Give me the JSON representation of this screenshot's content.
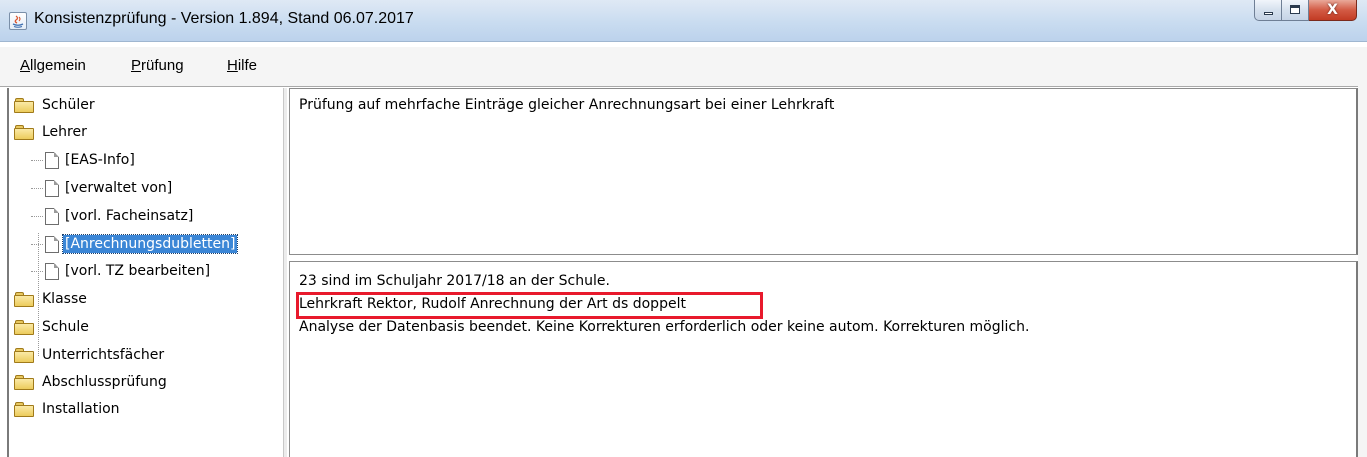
{
  "window": {
    "title": "Konsistenzprüfung - Version 1.894, Stand 06.07.2017",
    "app_icon": "java-icon",
    "buttons": {
      "minimize": "minimize",
      "maximize": "maximize",
      "close": "X"
    }
  },
  "menubar": {
    "items": [
      {
        "label": "Allgemein"
      },
      {
        "label": "Prüfung"
      },
      {
        "label": "Hilfe"
      }
    ]
  },
  "tree": {
    "items": [
      {
        "label": "Schüler",
        "type": "folder"
      },
      {
        "label": "Lehrer",
        "type": "folder"
      },
      {
        "label": "[EAS-Info]",
        "type": "document"
      },
      {
        "label": "[verwaltet von]",
        "type": "document"
      },
      {
        "label": "[vorl. Facheinsatz]",
        "type": "document"
      },
      {
        "label": "[Anrechnungsdubletten]",
        "type": "document",
        "selected": true
      },
      {
        "label": "[vorl. TZ bearbeiten]",
        "type": "document"
      },
      {
        "label": "Klasse",
        "type": "folder"
      },
      {
        "label": "Schule",
        "type": "folder"
      },
      {
        "label": "Unterrichtsfächer",
        "type": "folder"
      },
      {
        "label": "Abschlussprüfung",
        "type": "folder"
      },
      {
        "label": "Installation",
        "type": "folder"
      }
    ]
  },
  "description_panel": {
    "text": "Prüfung auf mehrfache Einträge gleicher Anrechnungsart bei einer Lehrkraft"
  },
  "result_panel": {
    "lines": [
      "23 sind im Schuljahr 2017/18 an der Schule.",
      "Lehrkraft Rektor, Rudolf Anrechnung der Art ds doppelt",
      "Analyse der Datenbasis beendet. Keine Korrekturen erforderlich oder keine autom. Korrekturen möglich."
    ],
    "highlight_color": "#e8192c"
  },
  "colors": {
    "selection": "#3b86d6",
    "folder": "#eccb5c"
  }
}
